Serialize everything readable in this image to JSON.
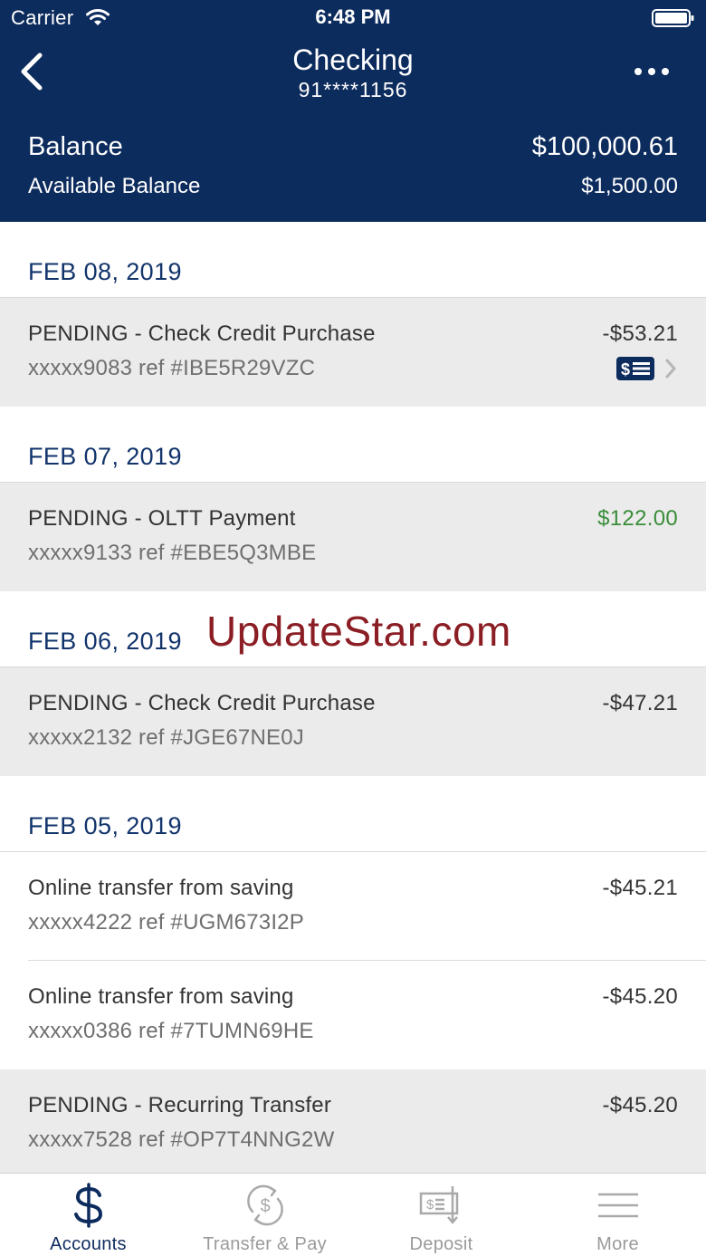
{
  "status_bar": {
    "carrier": "Carrier",
    "time": "6:48 PM"
  },
  "nav": {
    "title": "Checking",
    "account_number": "91****1156"
  },
  "balance": {
    "label": "Balance",
    "value": "$100,000.61",
    "available_label": "Available Balance",
    "available_value": "$1,500.00"
  },
  "groups": [
    {
      "date": "FEB 08, 2019",
      "transactions": [
        {
          "description": "PENDING - Check Credit Purchase",
          "reference": "xxxxx9083 ref #IBE5R29VZC",
          "amount": "-$53.21",
          "pending": true,
          "has_check_image": true
        }
      ]
    },
    {
      "date": "FEB 07, 2019",
      "transactions": [
        {
          "description": "PENDING - OLTT Payment",
          "reference": "xxxxx9133 ref #EBE5Q3MBE",
          "amount": "$122.00",
          "pending": true
        }
      ]
    },
    {
      "date": "FEB 06, 2019",
      "transactions": [
        {
          "description": "PENDING - Check Credit Purchase",
          "reference": "xxxxx2132 ref #JGE67NE0J",
          "amount": "-$47.21",
          "pending": true
        }
      ]
    },
    {
      "date": "FEB 05, 2019",
      "transactions": [
        {
          "description": "Online transfer from saving",
          "reference": "xxxxx4222 ref #UGM673I2P",
          "amount": "-$45.21",
          "pending": false
        },
        {
          "description": "Online transfer from saving",
          "reference": "xxxxx0386 ref #7TUMN69HE",
          "amount": "-$45.20",
          "pending": false
        },
        {
          "description": "PENDING - Recurring Transfer",
          "reference": "xxxxx7528 ref #OP7T4NNG2W",
          "amount": "-$45.20",
          "pending": true
        }
      ]
    }
  ],
  "watermark": "UpdateStar.com",
  "tabbar": {
    "tabs": [
      {
        "label": "Accounts",
        "icon": "dollar-icon",
        "active": true
      },
      {
        "label": "Transfer & Pay",
        "icon": "transfer-pay-icon",
        "active": false
      },
      {
        "label": "Deposit",
        "icon": "deposit-check-icon",
        "active": false
      },
      {
        "label": "More",
        "icon": "hamburger-menu-icon",
        "active": false
      }
    ]
  },
  "colors": {
    "header_bg": "#0d2c5e",
    "credit_green": "#3a8d3a",
    "pending_row_bg": "#ebebeb",
    "date_text": "#12346b",
    "watermark": "#8b1e24"
  }
}
